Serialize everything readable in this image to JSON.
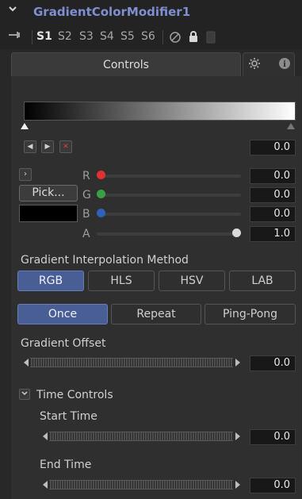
{
  "header": {
    "title": "GradientColorModifier1"
  },
  "version_tabs": [
    "S1",
    "S2",
    "S3",
    "S4",
    "S5",
    "S6"
  ],
  "active_version_tab": "S1",
  "tabs": {
    "controls_label": "Controls"
  },
  "gradient": {
    "position_value": "0.0"
  },
  "color": {
    "pick_label": "Pick...",
    "channels": [
      {
        "label": "R",
        "value": "0.0",
        "color": "#e03030",
        "level": 0.0
      },
      {
        "label": "G",
        "value": "0.0",
        "color": "#3aa046",
        "level": 0.0
      },
      {
        "label": "B",
        "value": "0.0",
        "color": "#2f62b8",
        "level": 0.0
      },
      {
        "label": "A",
        "value": "1.0",
        "color": "#d9d9d9",
        "level": 1.0
      }
    ]
  },
  "interpolation": {
    "label": "Gradient Interpolation Method",
    "options": [
      "RGB",
      "HLS",
      "HSV",
      "LAB"
    ],
    "selected": "RGB"
  },
  "repeat_mode": {
    "options": [
      "Once",
      "Repeat",
      "Ping-Pong"
    ],
    "selected": "Once"
  },
  "offset": {
    "label": "Gradient Offset",
    "value": "0.0"
  },
  "time_controls": {
    "label": "Time Controls",
    "start_label": "Start Time",
    "start_value": "0.0",
    "end_label": "End Time",
    "end_value": "0.0"
  },
  "colors": {
    "accent": "#4a5e96",
    "title": "#7f8fd2",
    "background": "#282828"
  }
}
